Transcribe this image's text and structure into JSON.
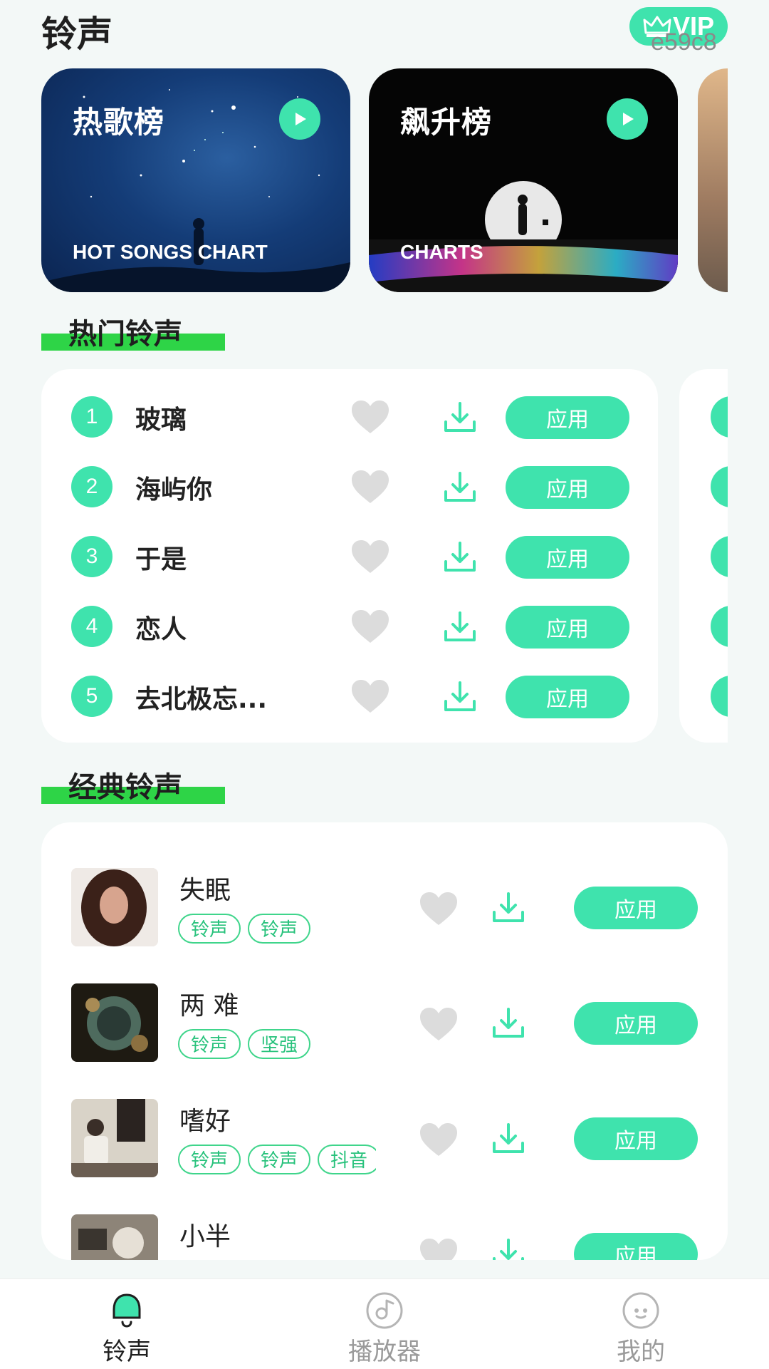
{
  "header": {
    "title": "铃声",
    "vip_label": "VIP",
    "overlay_text": "e59c8"
  },
  "banners": [
    {
      "title": "热歌榜",
      "subtitle": "HOT SONGS CHART"
    },
    {
      "title": "飙升榜",
      "subtitle": "CHARTS"
    }
  ],
  "hot_section": {
    "title": "热门铃声",
    "apply_label": "应用",
    "items": [
      {
        "rank": "1",
        "name": "玻璃"
      },
      {
        "rank": "2",
        "name": "海屿你"
      },
      {
        "rank": "3",
        "name": "于是"
      },
      {
        "rank": "4",
        "name": "恋人"
      },
      {
        "rank": "5",
        "name": "去北极忘..."
      }
    ]
  },
  "classic_section": {
    "title": "经典铃声",
    "apply_label": "应用",
    "items": [
      {
        "title": "失眠",
        "tags": [
          "铃声",
          "铃声"
        ]
      },
      {
        "title": "两 难",
        "tags": [
          "铃声",
          "坚强"
        ]
      },
      {
        "title": "嗜好",
        "tags": [
          "铃声",
          "铃声",
          "抖音"
        ]
      },
      {
        "title": "小半",
        "tags": []
      }
    ]
  },
  "bottom_nav": [
    {
      "label": "铃声",
      "active": true
    },
    {
      "label": "播放器",
      "active": false
    },
    {
      "label": "我的",
      "active": false
    }
  ],
  "colors": {
    "accent": "#3fe3ad",
    "section_bar": "#2ed447",
    "heart_gray": "#dcdcdc"
  }
}
